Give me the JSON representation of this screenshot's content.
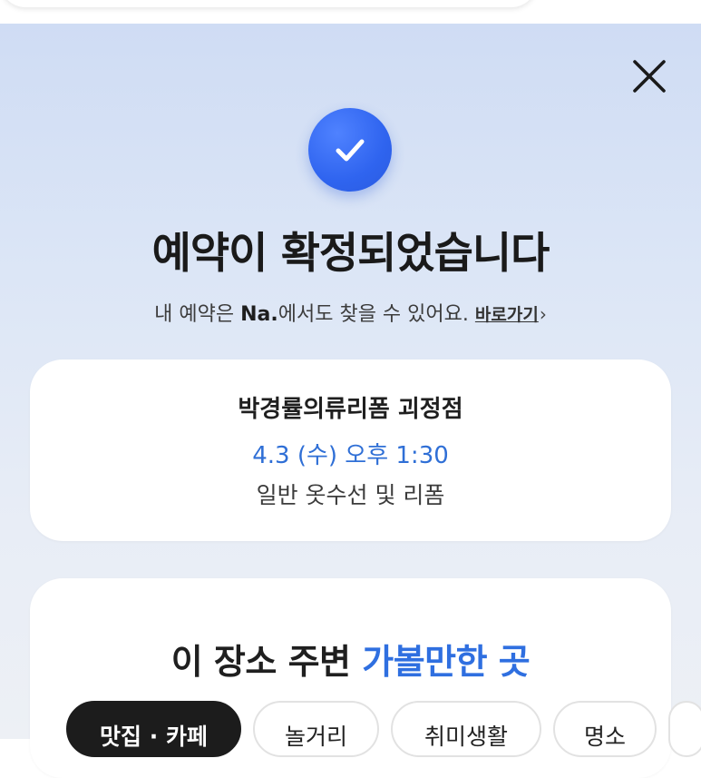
{
  "dialog": {
    "title": "예약이 확정되었습니다",
    "subline_prefix": "내 예약은 ",
    "subline_brand": "Na.",
    "subline_suffix": "에서도 찾을 수 있어요.",
    "shortcut_label": "바로가기",
    "shortcut_chevron": "›",
    "close_icon": "close-icon",
    "check_icon": "checkmark-icon"
  },
  "reservation": {
    "store_name": "박경률의류리폼 괴정점",
    "datetime": "4.3 (수) 오후 1:30",
    "service": "일반 옷수선 및 리폼"
  },
  "nearby": {
    "title_prefix": "이 장소 주변 ",
    "title_highlight": "가볼만한 곳",
    "tabs": [
      {
        "label": "맛집 · 카페",
        "active": true
      },
      {
        "label": "놀거리",
        "active": false
      },
      {
        "label": "취미생활",
        "active": false
      },
      {
        "label": "명소",
        "active": false
      }
    ]
  },
  "colors": {
    "accent_blue": "#2f6fe0",
    "check_blue": "#2f64ef",
    "active_chip": "#1c1c1c"
  }
}
